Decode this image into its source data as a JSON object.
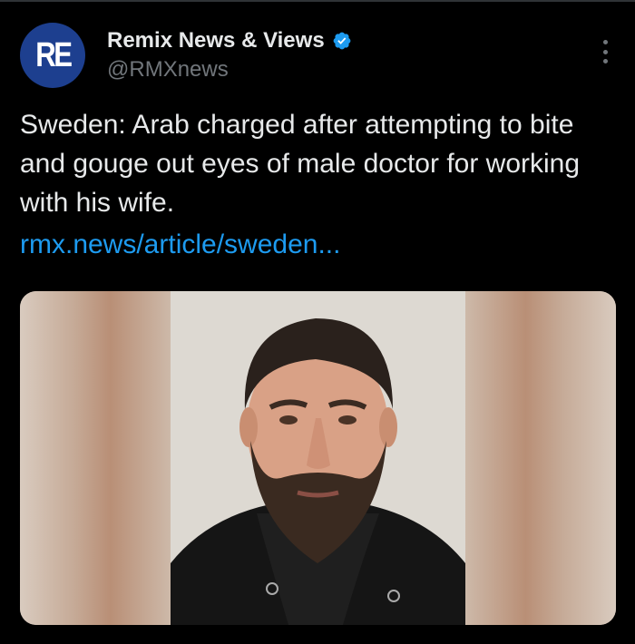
{
  "author": {
    "avatar_text": "RE",
    "display_name": "Remix News & Views",
    "handle": "@RMXnews",
    "verified_icon": "verified-badge-icon",
    "avatar_color": "#1d3f8f"
  },
  "tweet": {
    "text": "Sweden: Arab charged after attempting to bite and gouge out eyes of male doctor for working with his wife.",
    "link": "rmx.news/article/sweden..."
  },
  "media": {
    "description_icon": "mugshot-photo"
  },
  "colors": {
    "background": "#000000",
    "text": "#e7e9ea",
    "secondary": "#71767b",
    "link": "#1d9bf0"
  }
}
